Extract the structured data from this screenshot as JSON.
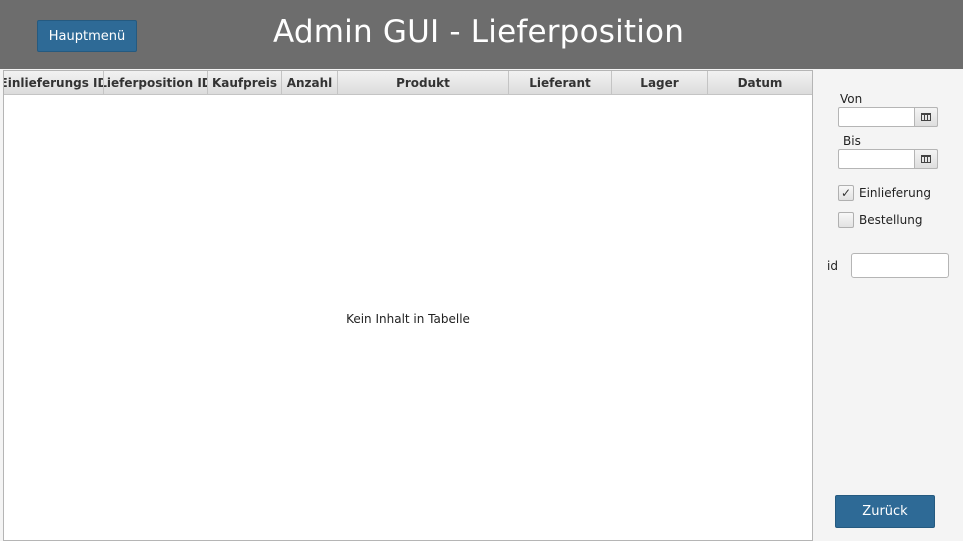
{
  "header": {
    "menu_button": "Hauptmenü",
    "title": "Admin GUI - Lieferposition"
  },
  "table": {
    "columns": [
      "Einlieferungs ID",
      "Lieferposition ID",
      "Kaufpreis",
      "Anzahl",
      "Produkt",
      "Lieferant",
      "Lager",
      "Datum"
    ],
    "empty_text": "Kein Inhalt in Tabelle"
  },
  "filters": {
    "from_label": "Von",
    "from_value": "",
    "to_label": "Bis",
    "to_value": "",
    "delivery_label": "Einlieferung",
    "delivery_checked": true,
    "order_label": "Bestellung",
    "order_checked": false,
    "id_label": "id",
    "id_value": ""
  },
  "footer": {
    "back_button": "Zurück"
  },
  "colors": {
    "header_bg": "#6d6d6d",
    "button_bg": "#2e6a96"
  },
  "icons": {
    "date_picker": "calendar-icon",
    "checkmark": "checkmark-icon"
  }
}
